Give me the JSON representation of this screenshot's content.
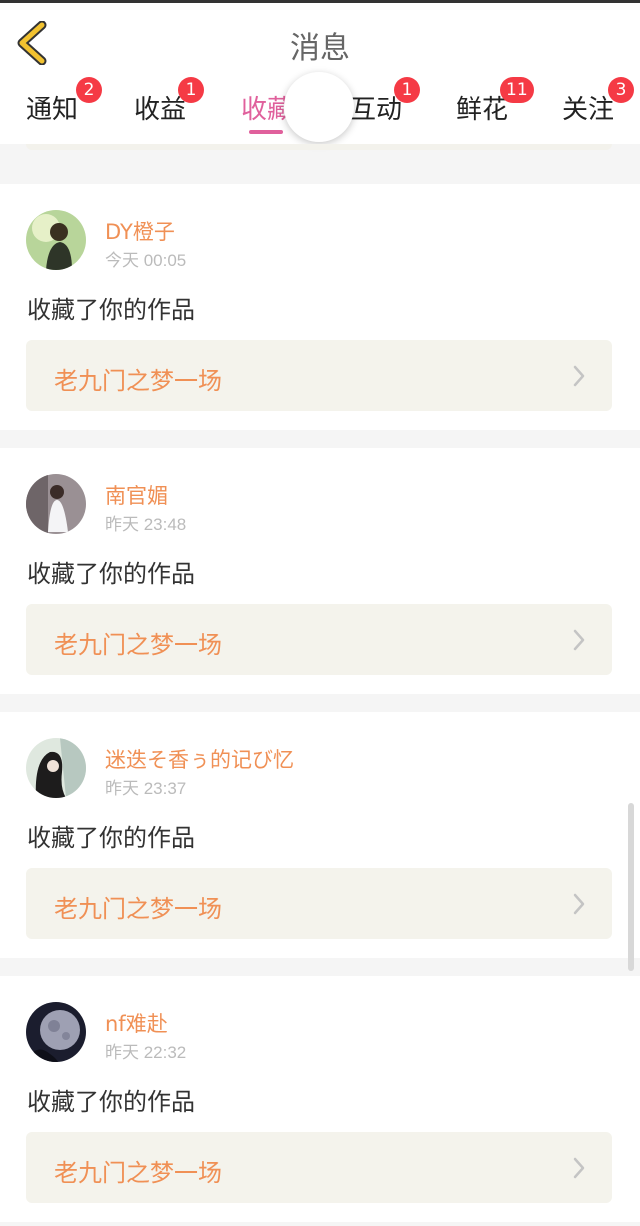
{
  "header": {
    "title": "消息",
    "back_icon": "back-chevron-icon"
  },
  "tabs": [
    {
      "label": "通知",
      "badge": "2"
    },
    {
      "label": "收益",
      "badge": "1"
    },
    {
      "label": "收藏",
      "badge": "",
      "active": true
    },
    {
      "label": "互动",
      "badge": "1"
    },
    {
      "label": "鲜花",
      "badge": "11"
    },
    {
      "label": "关注",
      "badge": "3"
    }
  ],
  "colors": {
    "accent": "#e0609c",
    "name": "#f09055",
    "badge": "#f53a45",
    "card_bg": "#f4f3ec"
  },
  "messages": [
    {
      "name": "DY橙子",
      "time": "今天 00:05",
      "action": "收藏了你的作品",
      "work": "老九门之梦一场"
    },
    {
      "name": "南官媚",
      "time": "昨天 23:48",
      "action": "收藏了你的作品",
      "work": "老九门之梦一场"
    },
    {
      "name": "迷迭そ香ぅ的记び忆",
      "time": "昨天 23:37",
      "action": "收藏了你的作品",
      "work": "老九门之梦一场"
    },
    {
      "name": "nf难赴",
      "time": "昨天 22:32",
      "action": "收藏了你的作品",
      "work": "老九门之梦一场"
    }
  ]
}
